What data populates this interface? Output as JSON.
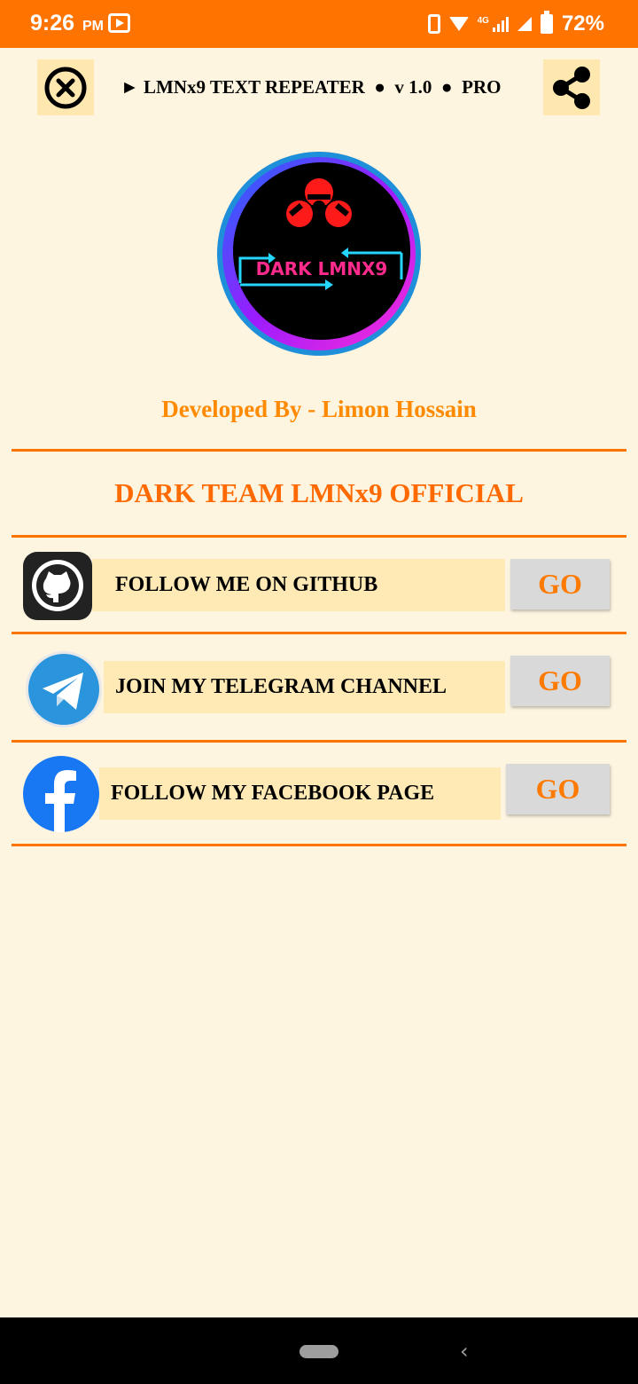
{
  "status_bar": {
    "time": "9:26",
    "ampm": "PM",
    "network": "4G",
    "battery": "72%"
  },
  "header": {
    "title": "► LMNx9 TEXT REPEATER  ●  v 1.0  ●  PRO",
    "close_icon": "close-circle-icon",
    "share_icon": "share-icon"
  },
  "logo": {
    "text": "DARK LMNX9"
  },
  "developer": "Developed By - Limon Hossain",
  "team": "DARK TEAM LMNx9 OFFICIAL",
  "links": [
    {
      "label": "FOLLOW ME ON GITHUB",
      "button": "GO",
      "icon": "github-icon"
    },
    {
      "label": "JOIN MY TELEGRAM CHANNEL",
      "button": "GO",
      "icon": "telegram-icon"
    },
    {
      "label": "FOLLOW MY FACEBOOK PAGE",
      "button": "GO",
      "icon": "facebook-icon"
    }
  ],
  "colors": {
    "accent": "#ff7300",
    "background": "#fdf5e0",
    "label_bg": "#ffeab5",
    "button_bg": "#d9d9d9"
  }
}
